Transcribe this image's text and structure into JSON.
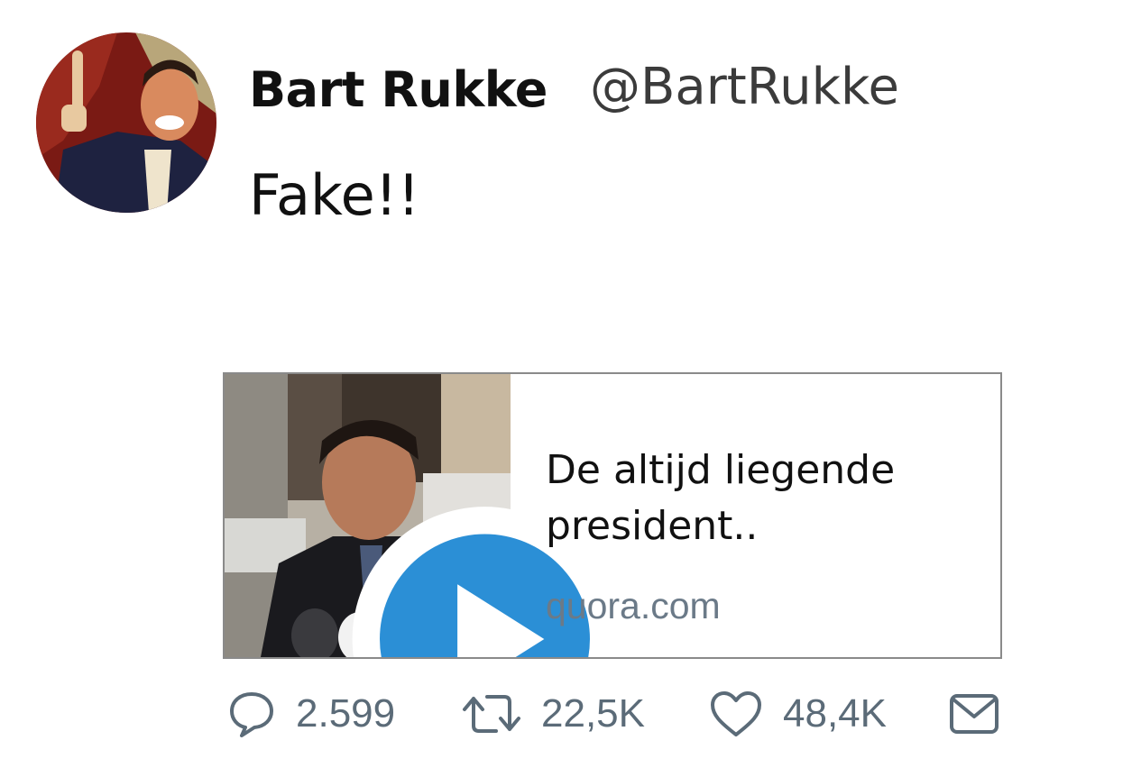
{
  "tweet": {
    "author_name": "Bart Rukke",
    "author_handle": "@BartRukke",
    "text": "Fake!!"
  },
  "card": {
    "title": "De altijd liegende president..",
    "domain": "quora.com"
  },
  "actions": {
    "replies": "2.599",
    "retweets": "22,5K",
    "likes": "48,4K"
  },
  "icons": {
    "reply": "reply-icon",
    "retweet": "retweet-icon",
    "like": "heart-icon",
    "message": "envelope-icon",
    "play": "play-icon"
  },
  "colors": {
    "action_gray": "#5b6b78",
    "domain_gray": "#6b7a88",
    "play_blue": "#2b8fd6",
    "card_border": "#8a8a8a"
  }
}
